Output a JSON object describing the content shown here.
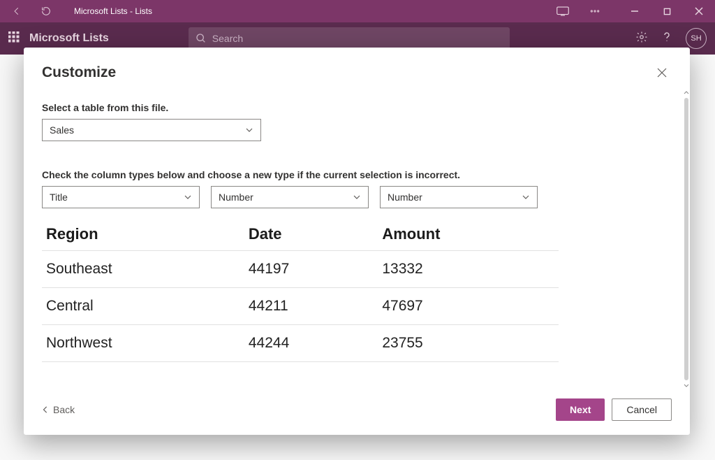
{
  "window": {
    "title": "Microsoft Lists - Lists"
  },
  "header": {
    "brand": "Microsoft Lists",
    "search_placeholder": "Search",
    "avatar_initials": "SH"
  },
  "modal": {
    "title": "Customize",
    "table_select_label": "Select a table from this file.",
    "table_select_value": "Sales",
    "column_types_label": "Check the column types below and choose a new type if the current selection is incorrect.",
    "column_types": [
      "Title",
      "Number",
      "Number"
    ],
    "preview": {
      "headers": [
        "Region",
        "Date",
        "Amount"
      ],
      "rows": [
        {
          "region": "Southeast",
          "date": "44197",
          "amount": "13332"
        },
        {
          "region": "Central",
          "date": "44211",
          "amount": "47697"
        },
        {
          "region": "Northwest",
          "date": "44244",
          "amount": "23755"
        }
      ]
    },
    "back_label": "Back",
    "next_label": "Next",
    "cancel_label": "Cancel"
  }
}
